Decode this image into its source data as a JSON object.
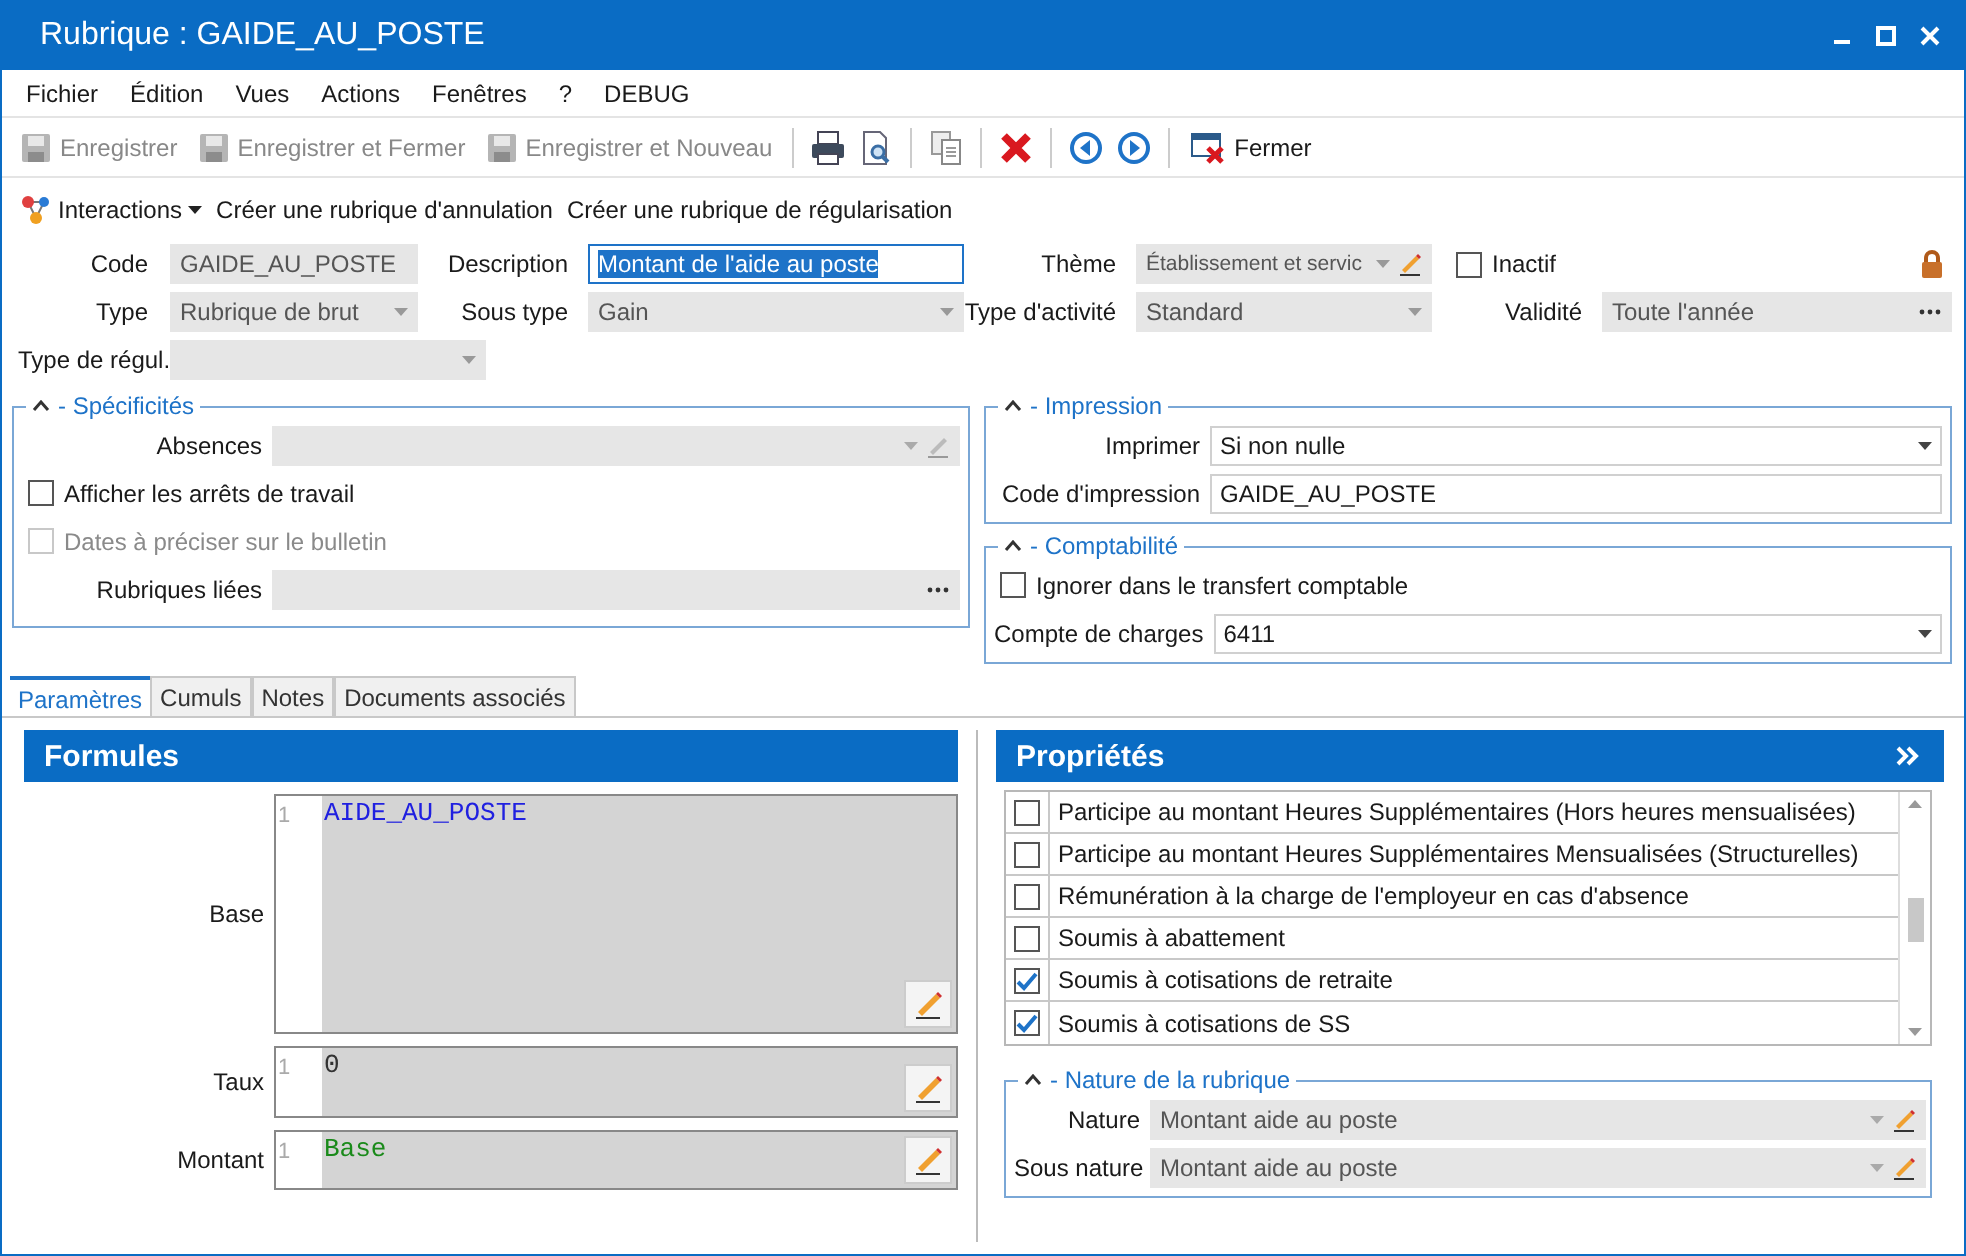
{
  "window": {
    "title": "Rubrique : GAIDE_AU_POSTE"
  },
  "menu": [
    "Fichier",
    "Édition",
    "Vues",
    "Actions",
    "Fenêtres",
    "?",
    "DEBUG"
  ],
  "toolbar": {
    "save_buttons": [
      {
        "label": "Enregistrer",
        "disabled": true
      },
      {
        "label": "Enregistrer et Fermer",
        "disabled": true
      },
      {
        "label": "Enregistrer et Nouveau",
        "disabled": true
      }
    ],
    "close_button": {
      "label": "Fermer"
    }
  },
  "actions": [
    {
      "label": "Interactions",
      "kind": "dropdown"
    },
    {
      "label": "Créer une rubrique d'annulation",
      "kind": "link"
    },
    {
      "label": "Créer une rubrique de régularisation",
      "kind": "link"
    }
  ],
  "header": {
    "code": {
      "label": "Code",
      "value": "GAIDE_AU_POSTE",
      "disabled": true
    },
    "description": {
      "label": "Description",
      "value": "Montant de l'aide au poste",
      "disabled": false,
      "highlighted": true
    },
    "theme": {
      "label": "Thème",
      "value": "Établissement et servic",
      "disabled": true
    },
    "inactif": {
      "label": "Inactif",
      "checked": false
    },
    "type": {
      "label": "Type",
      "value": "Rubrique de brut",
      "disabled": true
    },
    "sous_type": {
      "label": "Sous type",
      "value": "Gain",
      "disabled": true
    },
    "type_activite": {
      "label": "Type d'activité",
      "value": "Standard",
      "disabled": true
    },
    "validite": {
      "label": "Validité",
      "value": "Toute l'année",
      "disabled": true
    },
    "type_regul": {
      "label": "Type de régul.",
      "disabled": true
    }
  },
  "specificites": {
    "title": "- Spécificités",
    "absences": {
      "label": "Absences"
    },
    "checkboxes": [
      {
        "label": "Afficher les arrêts de travail",
        "checked": false,
        "disabled": false
      },
      {
        "label": "Dates à préciser sur le bulletin",
        "checked": false,
        "disabled": true
      }
    ],
    "rubriques_liees": {
      "label": "Rubriques liées"
    }
  },
  "impression": {
    "title": "- Impression",
    "imprimer": {
      "label": "Imprimer",
      "value": "Si non nulle"
    },
    "code": {
      "label": "Code d'impression",
      "value": "GAIDE_AU_POSTE"
    }
  },
  "comptabilite": {
    "title": "- Comptabilité",
    "checkbox": {
      "label": "Ignorer dans le transfert comptable",
      "checked": false
    },
    "compte": {
      "label": "Compte de charges",
      "value": "6411"
    }
  },
  "tabs": [
    {
      "label": "Paramètres",
      "selected": true
    },
    {
      "label": "Cumuls",
      "selected": false
    },
    {
      "label": "Notes",
      "selected": false
    },
    {
      "label": "Documents associés",
      "selected": false
    }
  ],
  "formules": {
    "title": "Formules",
    "fields": [
      {
        "label": "Base",
        "line": "1",
        "value": "AIDE_AU_POSTE",
        "kind": "identifier"
      },
      {
        "label": "Taux",
        "line": "1",
        "value": "0",
        "kind": "number"
      },
      {
        "label": "Montant",
        "line": "1",
        "value": "Base",
        "kind": "keyword"
      }
    ]
  },
  "proprietes": {
    "title": "Propriétés",
    "items": [
      {
        "label": "Participe au montant Heures Supplémentaires (Hors heures mensualisées)",
        "checked": false
      },
      {
        "label": "Participe au montant Heures Supplémentaires Mensualisées (Structurelles)",
        "checked": false
      },
      {
        "label": "Rémunération à la charge de l'employeur en cas d'absence",
        "checked": false
      },
      {
        "label": "Soumis à abattement",
        "checked": false
      },
      {
        "label": "Soumis à cotisations de retraite",
        "checked": true
      },
      {
        "label": "Soumis à cotisations de SS",
        "checked": true
      }
    ]
  },
  "nature": {
    "title": "- Nature de la rubrique",
    "fields": [
      {
        "label": "Nature",
        "value": "Montant aide au poste"
      },
      {
        "label": "Sous nature",
        "value": "Montant aide au poste"
      }
    ]
  }
}
